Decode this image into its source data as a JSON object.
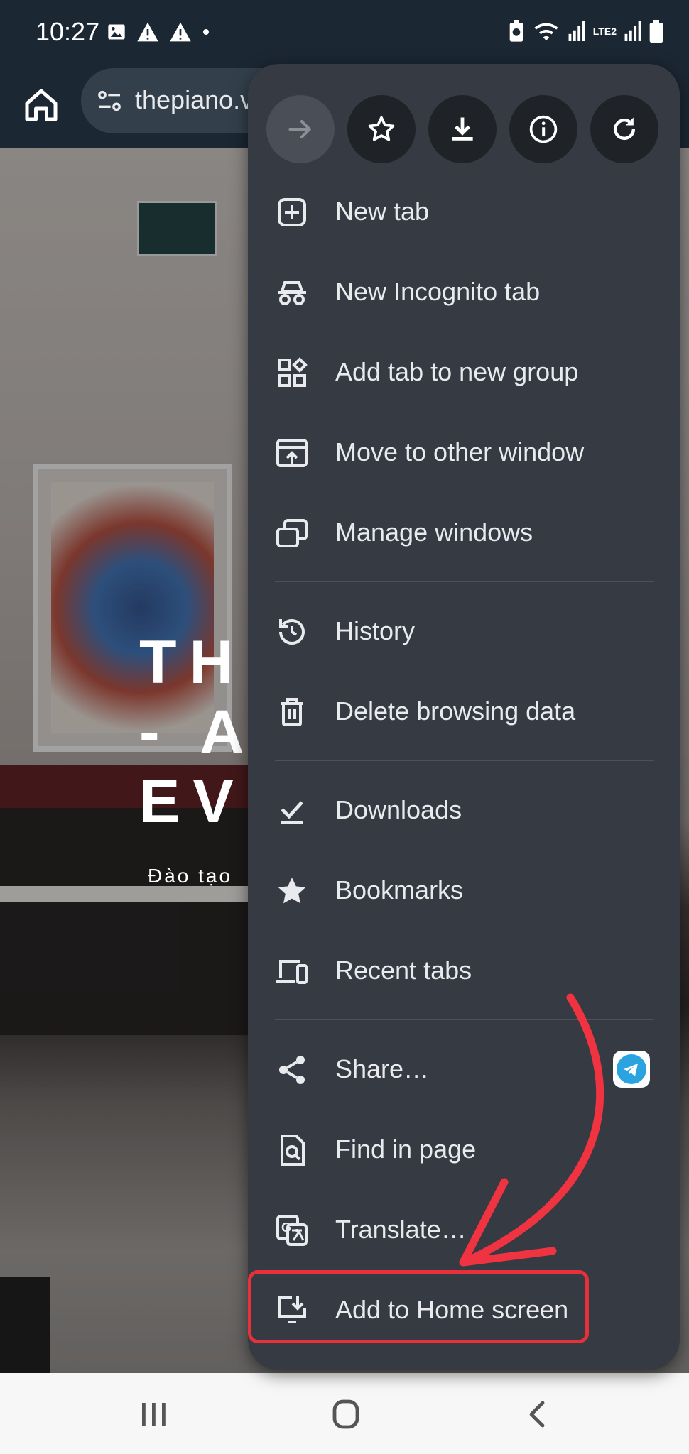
{
  "status_bar": {
    "time": "10:27",
    "network_label": "LTE2"
  },
  "toolbar": {
    "url": "thepiano.v"
  },
  "webpage": {
    "hero_title": "THE\n- A\nEV",
    "hero_subtitle": "Đào tạo"
  },
  "menu": {
    "items": [
      {
        "label": "New tab",
        "icon": "new-tab-icon"
      },
      {
        "label": "New Incognito tab",
        "icon": "incognito-icon"
      },
      {
        "label": "Add tab to new group",
        "icon": "tab-group-icon"
      },
      {
        "label": "Move to other window",
        "icon": "move-window-icon"
      },
      {
        "label": "Manage windows",
        "icon": "manage-windows-icon"
      },
      {
        "label": "History",
        "icon": "history-icon"
      },
      {
        "label": "Delete browsing data",
        "icon": "trash-icon"
      },
      {
        "label": "Downloads",
        "icon": "downloads-icon"
      },
      {
        "label": "Bookmarks",
        "icon": "star-filled-icon"
      },
      {
        "label": "Recent tabs",
        "icon": "devices-icon"
      },
      {
        "label": "Share…",
        "icon": "share-icon"
      },
      {
        "label": "Find in page",
        "icon": "find-in-page-icon"
      },
      {
        "label": "Translate…",
        "icon": "translate-icon"
      },
      {
        "label": "Add to Home screen",
        "icon": "add-to-home-icon"
      }
    ]
  },
  "colors": {
    "menu_bg": "#353a43",
    "highlight": "#e8303a",
    "toolbar_bg": "#1b2733"
  }
}
